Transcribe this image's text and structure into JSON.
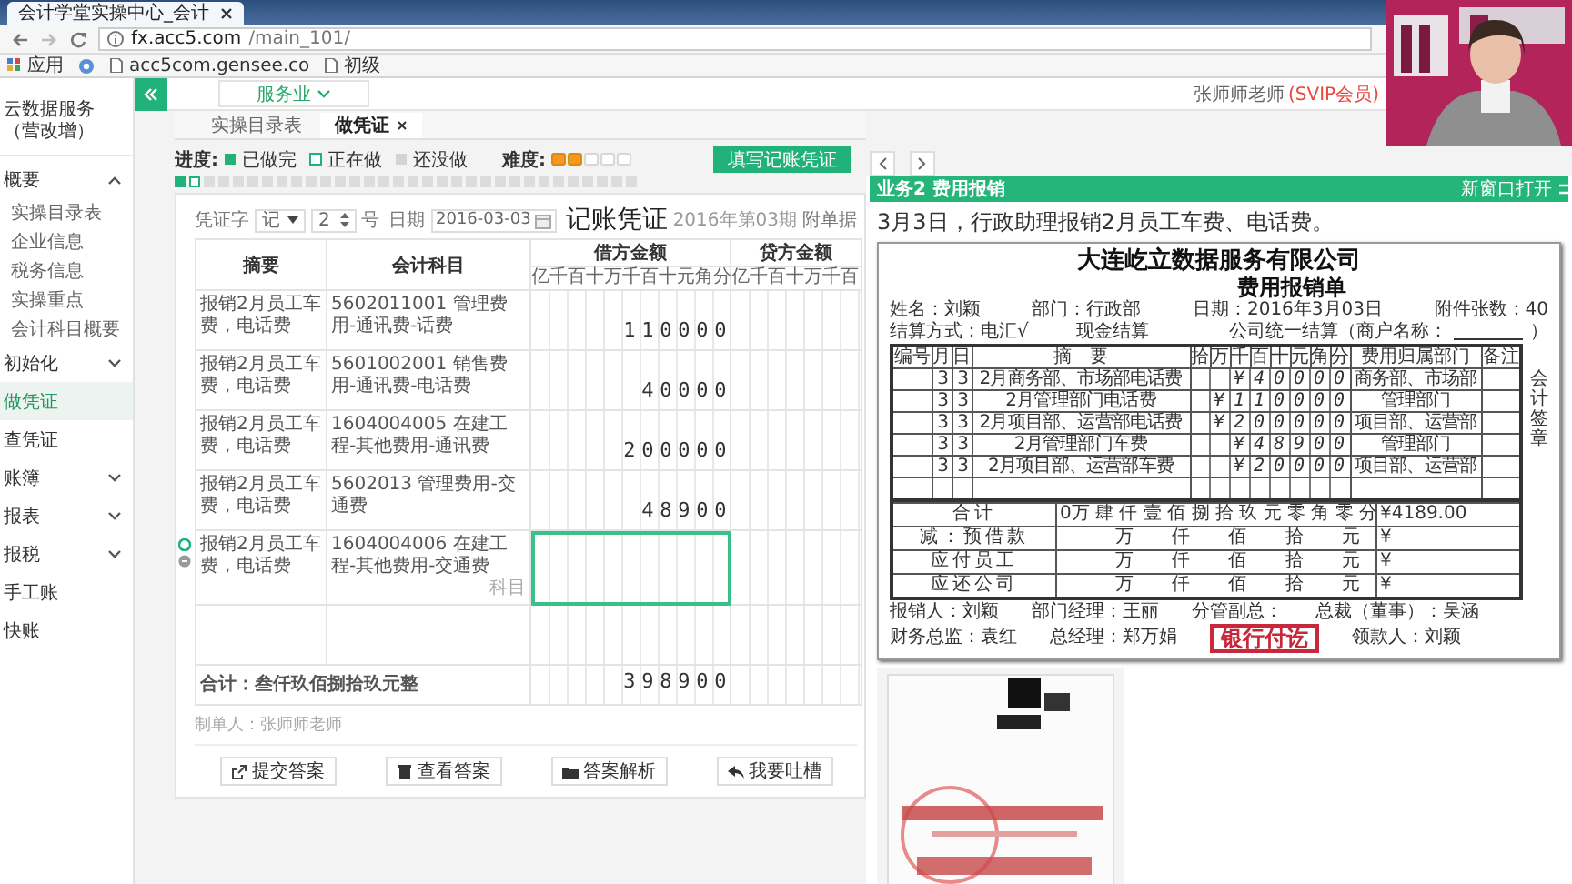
{
  "browser": {
    "tab_title": "会计学堂实操中心_会计",
    "address_host": "fx.acc5.com",
    "address_path": "/main_101/",
    "bookmarks": [
      "应用",
      "acc5com.gensee.co",
      "初级"
    ]
  },
  "header": {
    "industry": "服务业",
    "user": "张师师老师",
    "member": "(SVIP会员)"
  },
  "sidebar": {
    "title": "云数据服务（营改增）",
    "items": [
      {
        "label": "概要",
        "selected": false,
        "expanded": true,
        "children": [
          {
            "label": "实操目录表",
            "selected": false
          },
          {
            "label": "企业信息",
            "selected": false
          },
          {
            "label": "税务信息",
            "selected": false
          },
          {
            "label": "实操重点",
            "selected": false
          },
          {
            "label": "会计科目概要",
            "selected": false
          }
        ]
      },
      {
        "label": "初始化",
        "selected": false,
        "expanded": false
      },
      {
        "label": "做凭证",
        "selected": true
      },
      {
        "label": "查凭证",
        "selected": false
      },
      {
        "label": "账簿",
        "selected": false,
        "expanded": false
      },
      {
        "label": "报表",
        "selected": false,
        "expanded": false
      },
      {
        "label": "报税",
        "selected": false,
        "expanded": false
      },
      {
        "label": "手工账",
        "selected": false
      },
      {
        "label": "快账",
        "selected": false
      }
    ]
  },
  "tabs": [
    {
      "label": "实操目录表",
      "selected": false,
      "closable": false
    },
    {
      "label": "做凭证",
      "selected": true,
      "closable": true
    }
  ],
  "progress": {
    "label": "进度:",
    "legend": [
      {
        "kind": "done",
        "label": "已做完"
      },
      {
        "kind": "doing",
        "label": "正在做"
      },
      {
        "kind": "todo",
        "label": "还没做"
      }
    ],
    "difficulty_label": "难度:",
    "stars": 2,
    "steps": [
      {
        "kind": "done"
      },
      {
        "kind": "doing"
      },
      {
        "kind": "todo"
      },
      {
        "kind": "todo"
      },
      {
        "kind": "todo"
      },
      {
        "kind": "todo"
      },
      {
        "kind": "todo"
      },
      {
        "kind": "todo"
      },
      {
        "kind": "todo"
      },
      {
        "kind": "todo"
      },
      {
        "kind": "todo"
      },
      {
        "kind": "todo"
      },
      {
        "kind": "todo"
      },
      {
        "kind": "todo"
      },
      {
        "kind": "todo"
      },
      {
        "kind": "todo"
      },
      {
        "kind": "todo"
      },
      {
        "kind": "todo"
      },
      {
        "kind": "todo"
      },
      {
        "kind": "todo"
      },
      {
        "kind": "todo"
      },
      {
        "kind": "todo"
      },
      {
        "kind": "todo"
      },
      {
        "kind": "todo"
      },
      {
        "kind": "todo"
      },
      {
        "kind": "todo"
      },
      {
        "kind": "todo"
      },
      {
        "kind": "todo"
      },
      {
        "kind": "todo"
      },
      {
        "kind": "todo"
      },
      {
        "kind": "todo"
      },
      {
        "kind": "todo"
      }
    ]
  },
  "fill_button": "填写记账凭证",
  "voucher": {
    "word_label": "凭证字",
    "word": "记",
    "number": "2",
    "number_suffix": "号",
    "date_label": "日期",
    "date": "2016-03-03",
    "title": "记账凭证",
    "period": "2016年第03期",
    "attachments_label": "附单据",
    "summary_header": "摘要",
    "account_header": "会计科目",
    "debit_header": "借方金额",
    "credit_header": "贷方金额",
    "debit_digits": [
      "亿",
      "千",
      "百",
      "十",
      "万",
      "千",
      "百",
      "十",
      "元",
      "角",
      "分"
    ],
    "credit_digits": [
      "亿",
      "千",
      "百",
      "十",
      "万",
      "千",
      "百"
    ],
    "rows": [
      {
        "summary": "报销2月员工车费，电话费",
        "account": "5602011001 管理费用-通讯费-话费",
        "debit": "110000",
        "editing": false
      },
      {
        "summary": "报销2月员工车费，电话费",
        "account": "5601002001 销售费用-通讯费-电话费",
        "debit": "40000",
        "editing": false
      },
      {
        "summary": "报销2月员工车费，电话费",
        "account": "1604004005 在建工程-其他费用-通讯费",
        "debit": "200000",
        "editing": false
      },
      {
        "summary": "报销2月员工车费，电话费",
        "account": "5602013 管理费用-交通费",
        "debit": "48900",
        "editing": false
      },
      {
        "summary": "报销2月员工车费，电话费",
        "account": "1604004006 在建工程-其他费用-交通费",
        "account_hint": "科目",
        "editing": true
      }
    ],
    "total_label": "合计：叁仟玖佰捌拾玖元整",
    "total": "398900",
    "maker": "制单人：张师师老师"
  },
  "actions": [
    {
      "kind": "external",
      "label": "提交答案"
    },
    {
      "kind": "trash",
      "label": "查看答案"
    },
    {
      "kind": "folder",
      "label": "答案解析"
    },
    {
      "kind": "reply",
      "label": "我要吐槽"
    }
  ],
  "task": {
    "title": "业务2 费用报销",
    "open_new": "新窗口打开",
    "description": "3月3日，行政助理报销2月员工车费、电话费。"
  },
  "receipt": {
    "company": "大连屹立数据服务有限公司",
    "title": "费用报销单",
    "info": [
      "姓名：刘颖",
      "部门：行政部",
      "日期：2016年3月03日",
      "附件张数：40"
    ],
    "settlement": [
      "结算方式：电汇√",
      "现金结算",
      "公司统一结算（商户名称：",
      "）"
    ],
    "columns": [
      "编号",
      "月",
      "日",
      "摘　要",
      "拾",
      "万",
      "千",
      "百",
      "十",
      "元",
      "角",
      "分",
      "费用归属部门",
      "备注"
    ],
    "rows": [
      {
        "month": "3",
        "day": "3",
        "description": "2月商务部、市场部电话费",
        "amount": "¥40000",
        "department": "商务部、市场部"
      },
      {
        "month": "3",
        "day": "3",
        "description": "2月管理部门电话费",
        "amount": "¥110000",
        "department": "管理部门"
      },
      {
        "month": "3",
        "day": "3",
        "description": "2月项目部、运营部电话费",
        "amount": "¥200000",
        "department": "项目部、运营部"
      },
      {
        "month": "3",
        "day": "3",
        "description": "2月管理部门车费",
        "amount": "¥48900",
        "department": "管理部门"
      },
      {
        "month": "3",
        "day": "3",
        "description": "2月项目部、运营部车费",
        "amount": "¥20000",
        "department": "项目部、运营部"
      }
    ],
    "summary": [
      {
        "label": "合计",
        "words": "0万 肆 仟 壹 佰 捌 拾 玖 元 零 角 零 分",
        "amount": "¥4189.00"
      },
      {
        "label": "减：预借款",
        "units": "万 仟 佰 拾 元",
        "amount": "¥"
      },
      {
        "label": "应付员工",
        "units": "万 仟 佰 拾 元",
        "amount": "¥"
      },
      {
        "label": "应还公司",
        "units": "万 仟 佰 拾 元",
        "amount": "¥"
      }
    ],
    "signatures": [
      [
        "报销人：刘颖",
        "部门经理：王丽",
        "分管副总：",
        "总裁（董事）：吴涵"
      ],
      [
        "财务总监：袁红",
        "总经理：郑万娟",
        "领款人：刘颖"
      ]
    ],
    "stamp": "银行付讫",
    "side_label": "会计签章"
  }
}
